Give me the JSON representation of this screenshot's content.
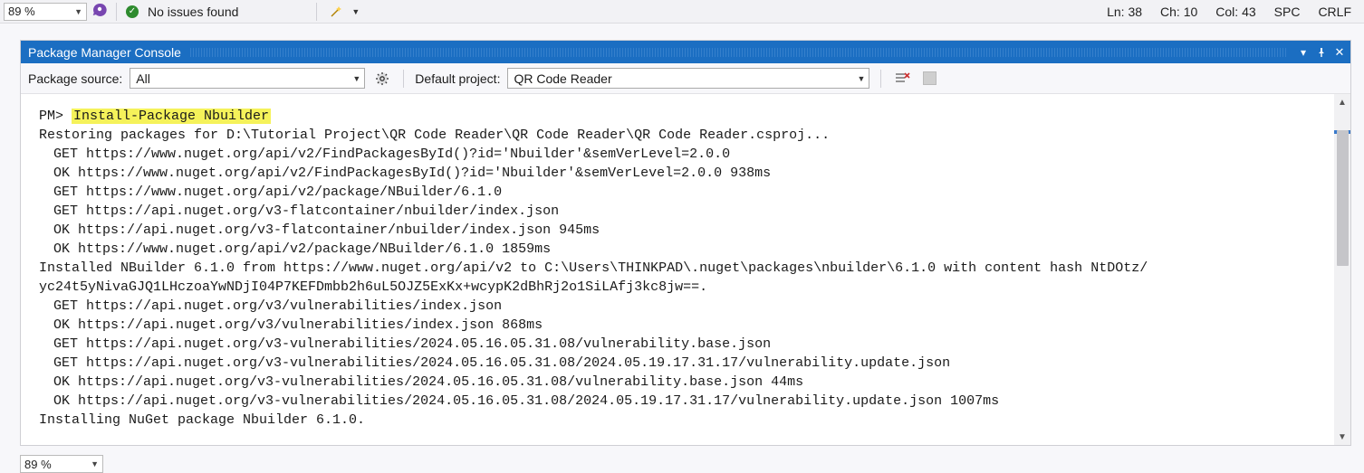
{
  "statusBar": {
    "zoom_top": "89 %",
    "issues_text": "No issues found",
    "ln": "Ln: 38",
    "ch": "Ch: 10",
    "col": "Col: 43",
    "spc": "SPC",
    "crlf": "CRLF"
  },
  "pmc": {
    "title": "Package Manager Console",
    "pkg_src_label": "Package source:",
    "pkg_src_value": "All",
    "def_proj_label": "Default project:",
    "def_proj_value": "QR Code Reader"
  },
  "console": {
    "prompt": "PM>",
    "command": "Install-Package Nbuilder",
    "lines": [
      "Restoring packages for D:\\Tutorial Project\\QR Code Reader\\QR Code Reader\\QR Code Reader.csproj...",
      "GET https://www.nuget.org/api/v2/FindPackagesById()?id='Nbuilder'&semVerLevel=2.0.0",
      "OK https://www.nuget.org/api/v2/FindPackagesById()?id='Nbuilder'&semVerLevel=2.0.0 938ms",
      "GET https://www.nuget.org/api/v2/package/NBuilder/6.1.0",
      "GET https://api.nuget.org/v3-flatcontainer/nbuilder/index.json",
      "OK https://api.nuget.org/v3-flatcontainer/nbuilder/index.json 945ms",
      "OK https://www.nuget.org/api/v2/package/NBuilder/6.1.0 1859ms",
      "Installed NBuilder 6.1.0 from https://www.nuget.org/api/v2 to C:\\Users\\THINKPAD\\.nuget\\packages\\nbuilder\\6.1.0 with content hash NtDOtz/",
      "yc24t5yNivaGJQ1LHczoaYwNDjI04P7KEFDmbb2h6uL5OJZ5ExKx+wcypK2dBhRj2o1SiLAfj3kc8jw==.",
      "GET https://api.nuget.org/v3/vulnerabilities/index.json",
      "OK https://api.nuget.org/v3/vulnerabilities/index.json 868ms",
      "GET https://api.nuget.org/v3-vulnerabilities/2024.05.16.05.31.08/vulnerability.base.json",
      "GET https://api.nuget.org/v3-vulnerabilities/2024.05.16.05.31.08/2024.05.19.17.31.17/vulnerability.update.json",
      "OK https://api.nuget.org/v3-vulnerabilities/2024.05.16.05.31.08/vulnerability.base.json 44ms",
      "OK https://api.nuget.org/v3-vulnerabilities/2024.05.16.05.31.08/2024.05.19.17.31.17/vulnerability.update.json 1007ms",
      "Installing NuGet package Nbuilder 6.1.0."
    ],
    "indent_flags": [
      false,
      true,
      true,
      true,
      true,
      true,
      true,
      false,
      false,
      true,
      true,
      true,
      true,
      true,
      true,
      false
    ]
  },
  "bottom": {
    "zoom_bottom": "89 %"
  }
}
